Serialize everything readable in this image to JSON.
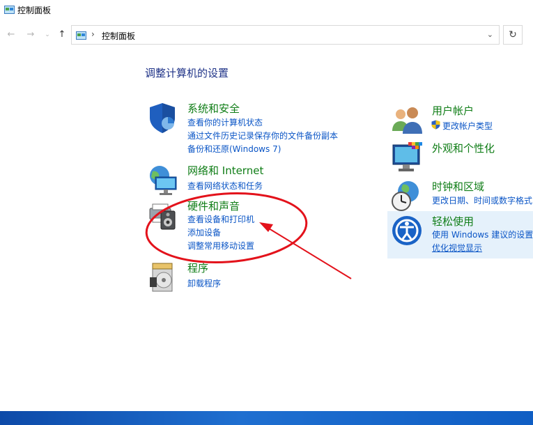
{
  "window": {
    "title": "控制面板"
  },
  "nav": {
    "back_icon": "arrow-left-icon",
    "forward_icon": "arrow-right-icon",
    "up_icon": "arrow-up-icon",
    "address_path": "控制面板",
    "refresh_icon": "refresh-icon"
  },
  "heading": "调整计算机的设置",
  "left_categories": [
    {
      "name": "系统和安全",
      "icon": "shield-icon",
      "links": [
        "查看你的计算机状态",
        "通过文件历史记录保存你的文件备份副本",
        "备份和还原(Windows 7)"
      ]
    },
    {
      "name": "网络和 Internet",
      "icon": "network-globe-icon",
      "links": [
        "查看网络状态和任务"
      ]
    },
    {
      "name": "硬件和声音",
      "icon": "printer-speaker-icon",
      "links": [
        "查看设备和打印机",
        "添加设备",
        "调整常用移动设置"
      ]
    },
    {
      "name": "程序",
      "icon": "programs-disc-icon",
      "links": [
        "卸载程序"
      ]
    }
  ],
  "right_categories": [
    {
      "name": "用户帐户",
      "icon": "users-icon",
      "links": [
        "更改帐户类型"
      ]
    },
    {
      "name": "外观和个性化",
      "icon": "monitor-palette-icon",
      "links": []
    },
    {
      "name": "时钟和区域",
      "icon": "clock-globe-icon",
      "links": [
        "更改日期、时间或数字格式"
      ]
    },
    {
      "name": "轻松使用",
      "icon": "ease-of-access-icon",
      "links": [
        "使用 Windows 建议的设置",
        "优化视觉显示"
      ]
    }
  ],
  "taskbar": {
    "label": ""
  },
  "colors": {
    "category": "#0f7d16",
    "link": "#0a55c6",
    "heading": "#1e3287",
    "annotation": "#e3121b"
  }
}
